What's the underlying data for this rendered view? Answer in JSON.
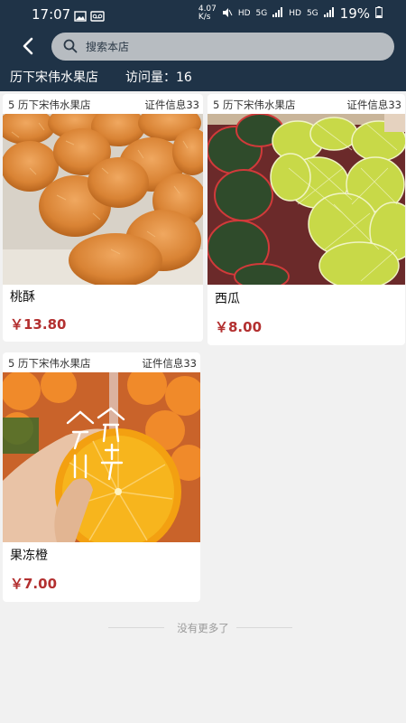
{
  "status_bar": {
    "time": "17:07",
    "speed": "4.07 K/s",
    "net1": "HD",
    "net2": "5G",
    "net3": "HD",
    "net4": "5G",
    "battery": "19%"
  },
  "nav": {
    "search_placeholder": "搜索本店"
  },
  "shop": {
    "name": "历下宋伟水果店",
    "visits": "访问量：16"
  },
  "products": [
    {
      "shop_label": "5 历下宋伟水果店",
      "cert": "证件信息33",
      "name": "桃酥",
      "price": "￥13.80"
    },
    {
      "shop_label": "5 历下宋伟水果店",
      "cert": "证件信息33",
      "name": "西瓜",
      "price": "￥8.00"
    },
    {
      "shop_label": "5 历下宋伟水果店",
      "cert": "证件信息33",
      "name": "果冻橙",
      "price": "￥7.00"
    }
  ],
  "footer": {
    "text": "没有更多了"
  },
  "colors": {
    "header": "#1f3347",
    "price": "#b33030",
    "background": "#f1f1f1"
  }
}
